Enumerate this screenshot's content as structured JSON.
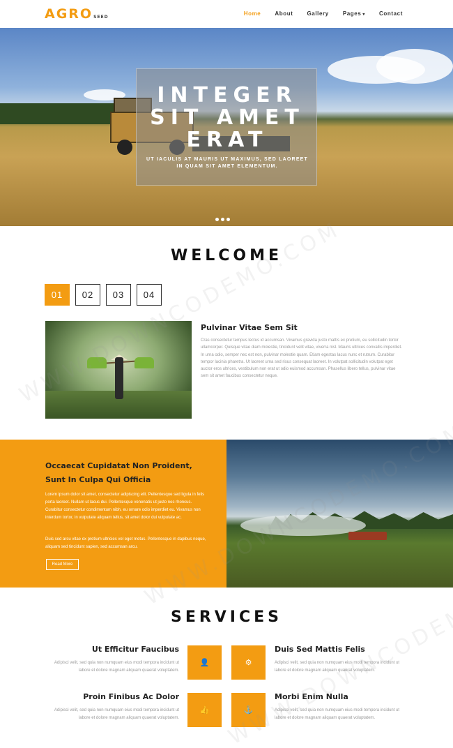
{
  "nav": {
    "logo": "AGRO",
    "logo_sub": "SEED",
    "items": [
      {
        "label": "Home"
      },
      {
        "label": "About"
      },
      {
        "label": "Gallery"
      },
      {
        "label": "Pages"
      },
      {
        "label": "Contact"
      }
    ],
    "pages_caret": "▾"
  },
  "hero": {
    "title": "INTEGER SIT AMET ERAT",
    "subtitle": "UT IACULIS AT MAURIS UT MAXIMUS, SED LAOREET IN QUAM SIT AMET ELEMENTUM."
  },
  "welcome": {
    "title": "WELCOME",
    "tabs": [
      "01",
      "02",
      "03",
      "04"
    ],
    "heading": "Pulvinar Vitae Sem Sit",
    "body": "Cras consectetur tempus lectus id accumsan. Vivamus gravida justo mattis ex pretium, eu sollicitudin tortor ullamcorper. Quisque vitae diam molestie, tincidunt velit vitae, viverra nisl. Mauris ultrices convallis imperdiet. In urna odio, semper nec est non, pulvinar molestie quam. Etiam egestas lacus nunc et rutrum. Curabitur tempor lacinia pharetra. Ut laoreet urna sed risus consequat laoreet. In volutpat sollicitudin volutpat eget auctor eros ultrices, vestibulum non erat ut odio euismod accumsan. Phasellus libero tellus, pulvinar vitae sem sit amet faucibus consectetur neque."
  },
  "feature": {
    "heading": "Occaecat Cupidatat Non Proident, Sunt In Culpa Qui Officia",
    "para1": "Lorem ipsum dolor sit amet, consectetur adipiscing elit. Pellentesque sed ligula in felis porta laoreet. Nullam ut lacus dui. Pellentesque venenatis ut justo nec rhoncus. Curabitur consectetur condimentum nibh, eu ornare odio imperdiet eu. Vivamus non interdum tortor, in vulputate aliquam tellus, sit amet dolor dui vulputate ac.",
    "para2": "Duis sed arcu vitae ex pretium ultricies vel eget metus. Pellentesque in dapibus neque, aliquam sed tincidunt sapien, sed accumsan arcu.",
    "button": "Read More"
  },
  "services": {
    "title": "SERVICES",
    "items": [
      {
        "title": "Ut Efficitur Faucibus",
        "text": "Adipisci velit, sed quia non numquam eius modi tempora incidunt ut labore et dolore magnam aliquam quaerat voluptatem.",
        "icon": "user-icon",
        "glyph": "👤"
      },
      {
        "title": "Duis Sed Mattis Felis",
        "text": "Adipisci velit, sed quia non numquam eius modi tempora incidunt ut labore et dolore magnam aliquam quaerat voluptatem.",
        "icon": "gear-icon",
        "glyph": "⚙"
      },
      {
        "title": "Proin Finibus Ac Dolor",
        "text": "Adipisci velit, sed quia non numquam eius modi tempora incidunt ut labore et dolore magnam aliquam quaerat voluptatem.",
        "icon": "thumbs-up-icon",
        "glyph": "👍"
      },
      {
        "title": "Morbi Enim Nulla",
        "text": "Adipisci velit, sed quia non numquam eius modi tempora incidunt ut labore et dolore magnam aliquam quaerat voluptatem.",
        "icon": "anchor-icon",
        "glyph": "⚓"
      }
    ]
  },
  "watermark": "WWW.DOWNCODEMO.COM",
  "colors": {
    "accent": "#f39c12"
  }
}
